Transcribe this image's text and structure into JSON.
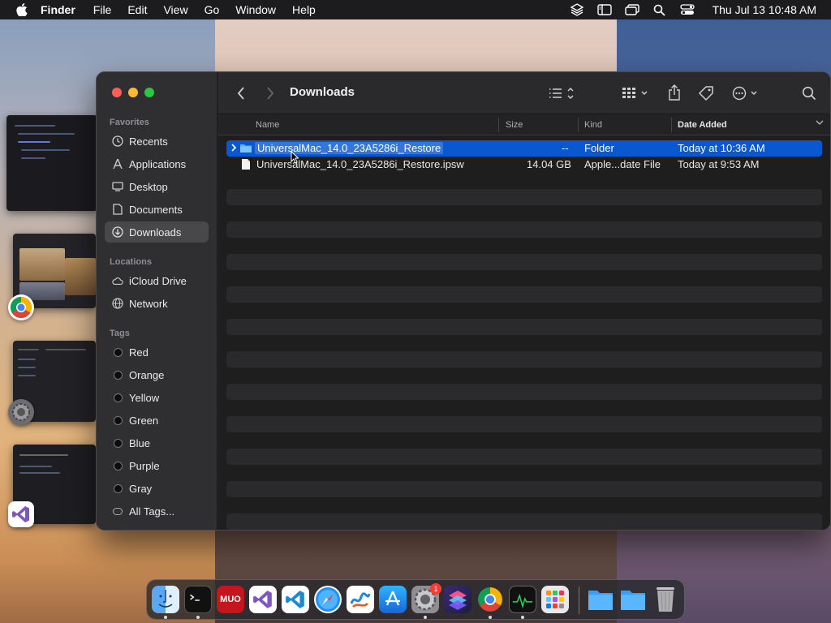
{
  "menubar": {
    "app_name": "Finder",
    "items": [
      "File",
      "Edit",
      "View",
      "Go",
      "Window",
      "Help"
    ],
    "status_icons": [
      "layers-icon",
      "sidebar-icon",
      "screen-mirror-icon",
      "search-icon",
      "control-center-icon"
    ],
    "clock": "Thu Jul 13  10:48 AM"
  },
  "finder": {
    "title": "Downloads",
    "sidebar": {
      "favorites_label": "Favorites",
      "favorites": [
        {
          "label": "Recents",
          "icon": "clock-icon"
        },
        {
          "label": "Applications",
          "icon": "applications-icon"
        },
        {
          "label": "Desktop",
          "icon": "desktop-icon"
        },
        {
          "label": "Documents",
          "icon": "document-icon"
        },
        {
          "label": "Downloads",
          "icon": "download-icon"
        }
      ],
      "locations_label": "Locations",
      "locations": [
        {
          "label": "iCloud Drive",
          "icon": "cloud-icon"
        },
        {
          "label": "Network",
          "icon": "globe-icon"
        }
      ],
      "tags_label": "Tags",
      "tags": [
        "Red",
        "Orange",
        "Yellow",
        "Green",
        "Blue",
        "Purple",
        "Gray",
        "All Tags..."
      ]
    },
    "columns": {
      "name": "Name",
      "size": "Size",
      "kind": "Kind",
      "date_added": "Date Added"
    },
    "files": [
      {
        "name": "UniversalMac_14.0_23A5286i_Restore",
        "size": "--",
        "kind": "Folder",
        "date_added": "Today at 10:36 AM",
        "selected": true,
        "type": "folder"
      },
      {
        "name": "UniversalMac_14.0_23A5286i_Restore.ipsw",
        "size": "14.04 GB",
        "kind": "Apple...date File",
        "date_added": "Today at 9:53 AM",
        "selected": false,
        "type": "file"
      }
    ]
  },
  "dock": {
    "apps": [
      {
        "name": "finder-icon",
        "running": true
      },
      {
        "name": "terminal-icon",
        "running": true
      },
      {
        "name": "muo-icon",
        "label": "MUO",
        "running": false
      },
      {
        "name": "visual-studio-icon",
        "running": false
      },
      {
        "name": "vscode-icon",
        "running": false
      },
      {
        "name": "safari-icon",
        "running": false
      },
      {
        "name": "freeform-icon",
        "running": false
      },
      {
        "name": "app-store-icon",
        "running": false
      },
      {
        "name": "system-settings-icon",
        "running": true,
        "badge": "1"
      },
      {
        "name": "shortcuts-icon",
        "running": false
      },
      {
        "name": "chrome-icon",
        "running": true
      },
      {
        "name": "activity-monitor-icon",
        "running": true
      },
      {
        "name": "launchpad-icon",
        "running": false
      },
      {
        "name": "applications-folder-icon",
        "running": false
      },
      {
        "name": "downloads-folder-icon",
        "running": false
      },
      {
        "name": "trash-icon",
        "running": false
      }
    ]
  }
}
